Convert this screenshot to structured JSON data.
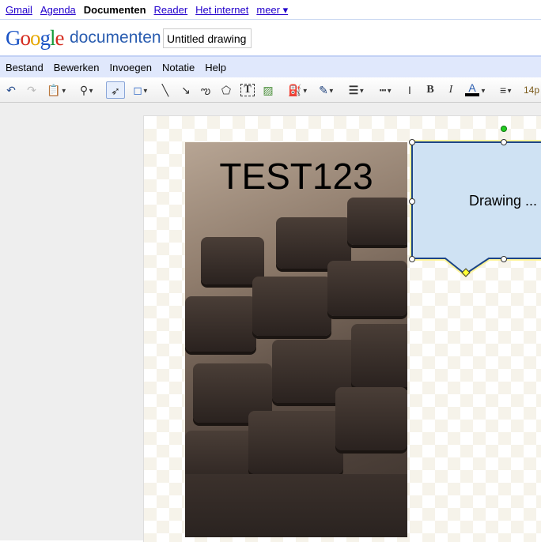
{
  "topnav": {
    "items": [
      "Gmail",
      "Agenda",
      "Documenten",
      "Reader",
      "Het internet",
      "meer ▾"
    ]
  },
  "header": {
    "logo": "Google",
    "product": "documenten",
    "title_value": "Untitled drawing"
  },
  "menu": [
    "Bestand",
    "Bewerken",
    "Invoegen",
    "Notatie",
    "Help"
  ],
  "toolbar": {
    "font_size": "14p",
    "bold": "B",
    "italic": "I",
    "text_color": "A"
  },
  "canvas": {
    "image_caption": "TEST123",
    "callout_text": "Drawing ..."
  },
  "colors": {
    "callout_fill": "#cfe2f3",
    "callout_border": "#1c4587",
    "selection": "#fff59d"
  }
}
